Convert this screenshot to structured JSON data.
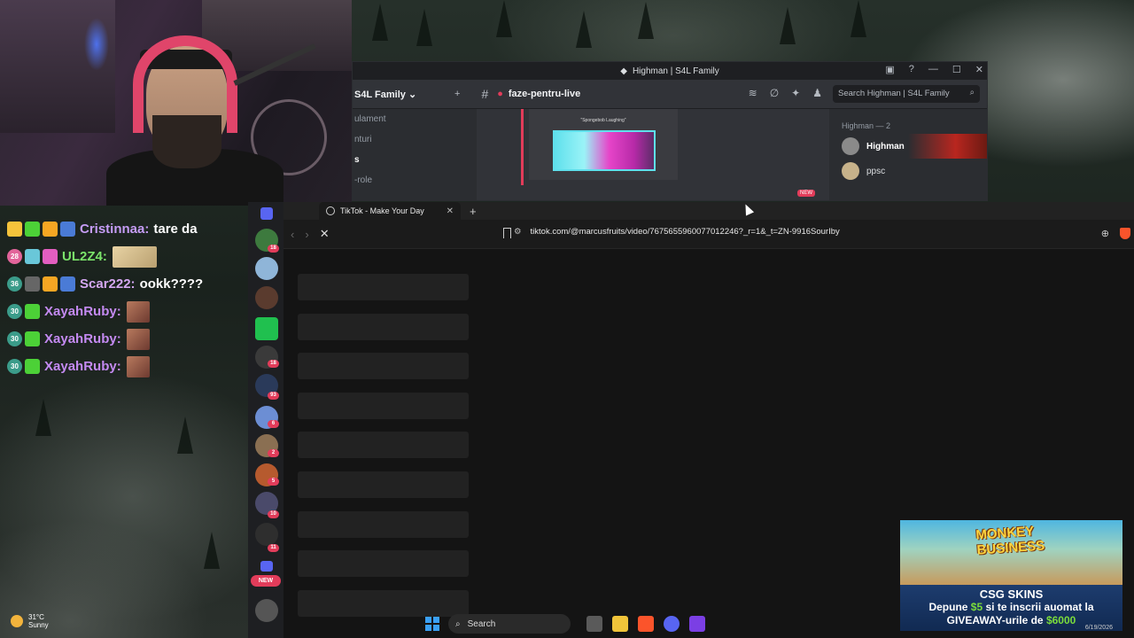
{
  "chat": {
    "lines": [
      {
        "user": "Cristinnaa:",
        "color": "#c59cf5",
        "message": "tare da",
        "badge_num": ""
      },
      {
        "user": "UL2Z4:",
        "color": "#7be36a",
        "message": "",
        "badge_num": "28"
      },
      {
        "user": "Scar222:",
        "color": "#d4a7f2",
        "message": "ookk????",
        "badge_num": "36"
      },
      {
        "user": "XayahRuby:",
        "color": "#c48af2",
        "message": "",
        "badge_num": "30"
      },
      {
        "user": "XayahRuby:",
        "color": "#c48af2",
        "message": "",
        "badge_num": "30"
      },
      {
        "user": "XayahRuby:",
        "color": "#c48af2",
        "message": "",
        "badge_num": "30"
      }
    ]
  },
  "weather": {
    "temp": "31°C",
    "condition": "Sunny"
  },
  "discord": {
    "window_title": "Highman | S4L Family",
    "server_name": "S4L Family",
    "channel_name": "faze-pentru-live",
    "search_placeholder": "Search Highman | S4L Family",
    "channels": [
      "ulament",
      "nturi",
      "s",
      "-role"
    ],
    "members_header": "Highman — 2",
    "members": [
      {
        "name": "Highman",
        "color": "#ffffff"
      },
      {
        "name": "ppsc",
        "color": "#dbdee1"
      }
    ],
    "video_caption": "\"Spongebob Laughing\"",
    "new_tag": "NEW"
  },
  "browser": {
    "tab_title": "TikTok - Make Your Day",
    "url": "tiktok.com/@marcusfruits/video/7675655960077012246?_r=1&_t=ZN-9916SourIby"
  },
  "rail": {
    "badges": [
      "18",
      "18",
      "93",
      "6",
      "2",
      "5",
      "10",
      "11"
    ],
    "new_label": "NEW"
  },
  "ad": {
    "title_line1": "MONKEY",
    "title_line2": "BUSINESS",
    "brand": "CSG SKINS",
    "text_prefix": "Depune ",
    "amount1": "$5",
    "text_mid": " si te inscrii auomat la",
    "text_line2": "GIVEAWAY-urile de ",
    "amount2": "$6000"
  },
  "taskbar": {
    "search_label": "Search",
    "date": "6/19/2026"
  },
  "colors": {
    "accent_red": "#e23c5a",
    "discord_bg": "#313338",
    "brave": "#fb542b"
  }
}
